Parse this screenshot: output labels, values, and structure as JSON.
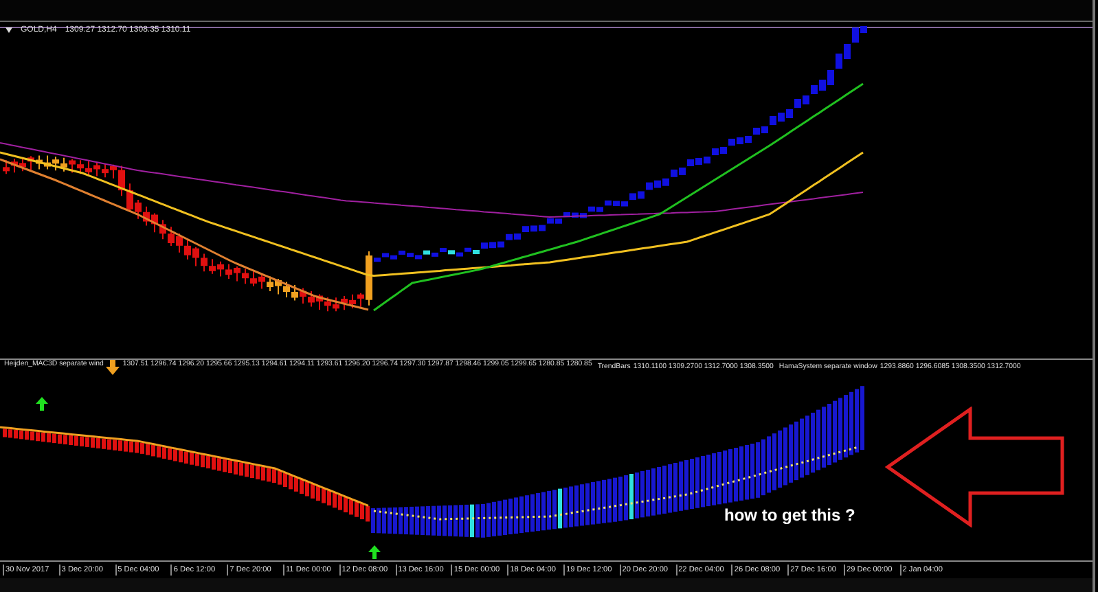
{
  "chart": {
    "symbol": "GOLD,H4",
    "quote": "1309.27 1312.70 1308.35 1310.11"
  },
  "indicators": [
    {
      "name": "Heijden_MAC3D separate wind",
      "values": "1307.51 1296.74 1296.20 1295.66 1295.13 1294.61 1294.11 1293.61 1296.20 1296.74 1297.30 1297.87 1298.46 1299.05 1299.65 1280.85 1280.85"
    },
    {
      "name": "TrendBars",
      "values": "1310.1100 1309.2700 1312.7000 1308.3500"
    },
    {
      "name": "HamaSystem separate window",
      "values": "1293.8860 1296.6085 1308.3500 1312.7000"
    }
  ],
  "time_axis": [
    "30 Nov 2017",
    "3 Dec 20:00",
    "5 Dec 04:00",
    "6 Dec 12:00",
    "7 Dec 20:00",
    "11 Dec 00:00",
    "12 Dec 08:00",
    "13 Dec 16:00",
    "15 Dec 00:00",
    "18 Dec 04:00",
    "19 Dec 12:00",
    "20 Dec 20:00",
    "22 Dec 04:00",
    "26 Dec 08:00",
    "27 Dec 16:00",
    "29 Dec 00:00",
    "2 Jan 04:00"
  ],
  "annotation": {
    "text": "how to get this ?"
  }
}
